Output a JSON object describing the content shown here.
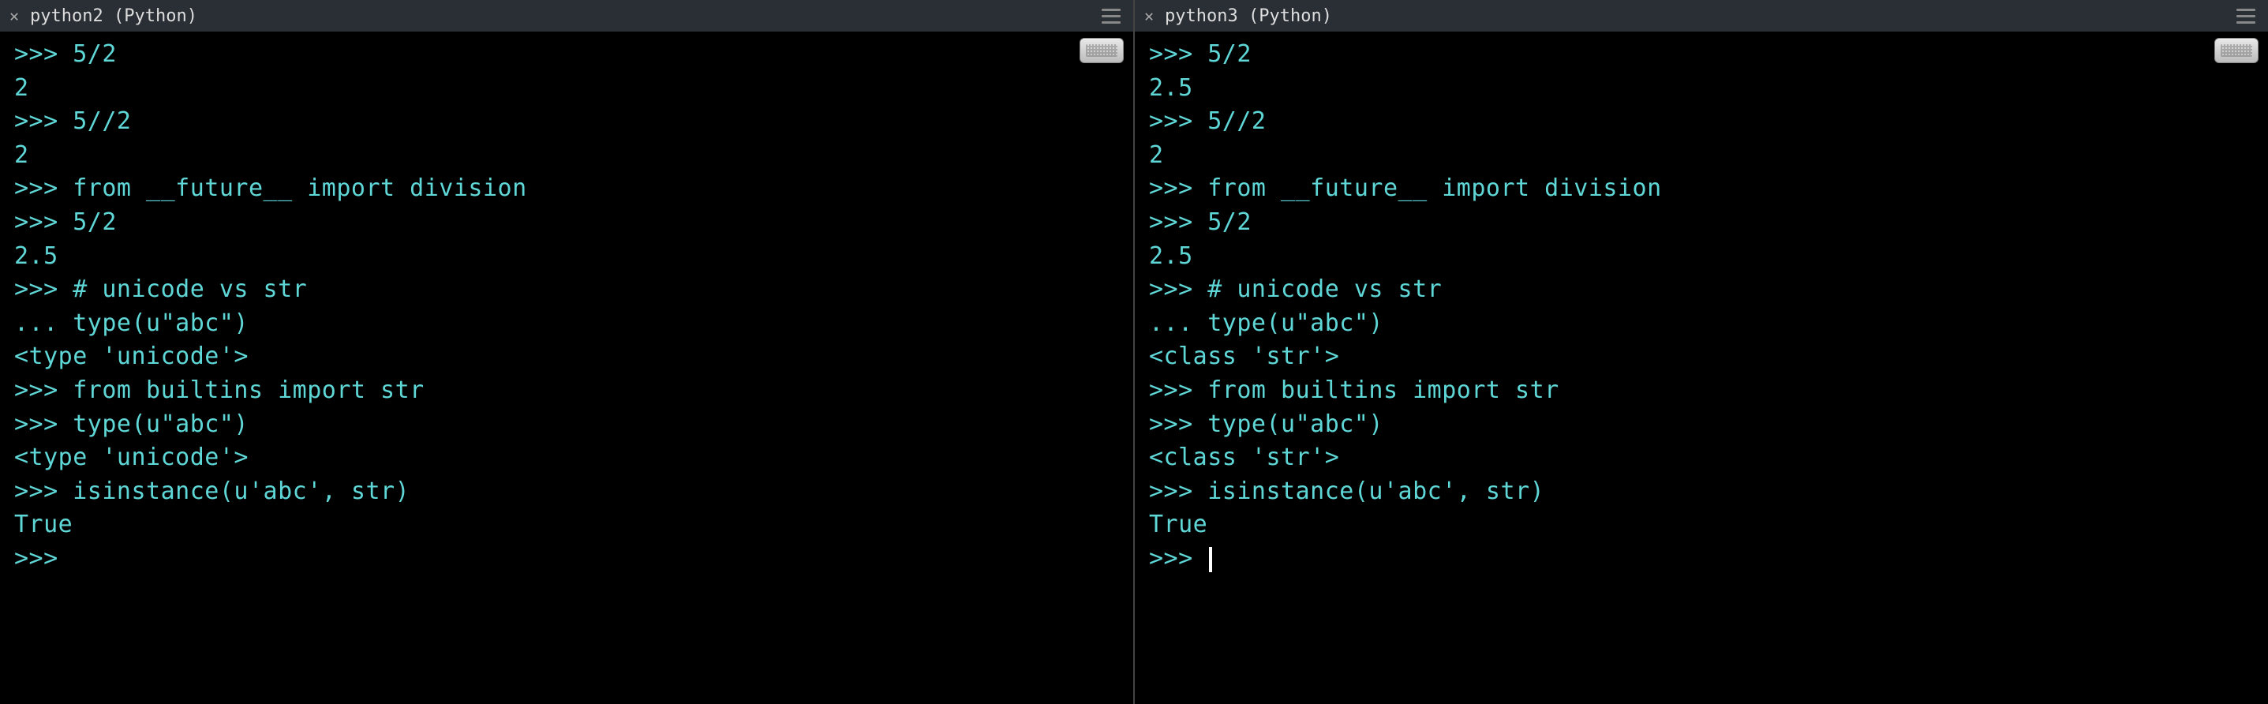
{
  "panes": [
    {
      "tab_title": "python2 (Python)",
      "show_cursor": false,
      "lines": [
        ">>> 5/2",
        "2",
        ">>> 5//2",
        "2",
        ">>> from __future__ import division",
        ">>> 5/2",
        "2.5",
        ">>> # unicode vs str",
        "... type(u\"abc\")",
        "<type 'unicode'>",
        ">>> from builtins import str",
        ">>> type(u\"abc\")",
        "<type 'unicode'>",
        ">>> isinstance(u'abc', str)",
        "True",
        ">>> "
      ]
    },
    {
      "tab_title": "python3 (Python)",
      "show_cursor": true,
      "lines": [
        ">>> 5/2",
        "2.5",
        ">>> 5//2",
        "2",
        ">>> from __future__ import division",
        ">>> 5/2",
        "2.5",
        ">>> # unicode vs str",
        "... type(u\"abc\")",
        "<class 'str'>",
        ">>> from builtins import str",
        ">>> type(u\"abc\")",
        "<class 'str'>",
        ">>> isinstance(u'abc', str)",
        "True",
        ">>> "
      ]
    }
  ],
  "colors": {
    "terminal_fg": "#5fd7d7",
    "terminal_bg": "#000000",
    "tabbar_bg": "#2a2f35"
  }
}
